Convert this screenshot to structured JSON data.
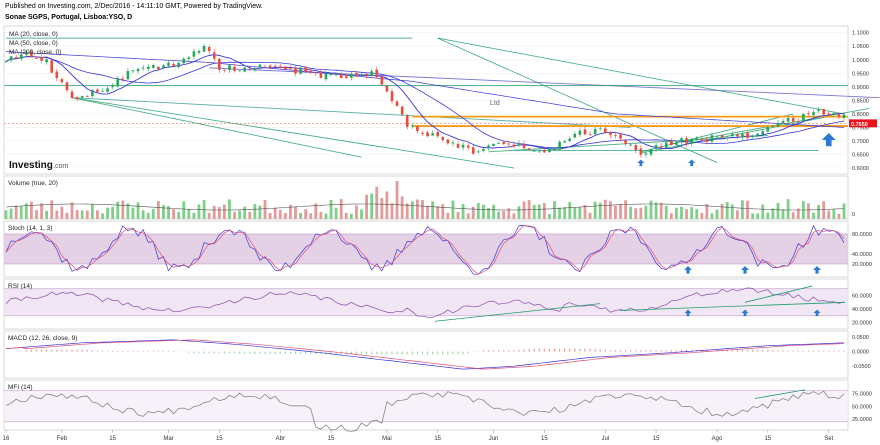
{
  "header": {
    "line1": "Published on Investing.com, 2/Dec/2016 - 14:11:10 GMT, Powered by TradingView.",
    "line2": "Sonae SGPS, Portugal, Lisboa:YSO, D"
  },
  "colors": {
    "up": "#26a65b",
    "down": "#e74c3c",
    "ma": "#3a36d8",
    "orange": "#f59c1a",
    "trend": "#1e9e6a",
    "arrow": "#2b7bd4",
    "stoch_bg": "#dec6e0",
    "rsi_bg": "#ede0f0",
    "mfi_bg": "#f5eef8",
    "price_tag": "#e8121b"
  },
  "chart_data": [
    {
      "type": "candlestick",
      "panel": "price",
      "legend": [
        "MA (20, close, 0)",
        "MA (50, close, 0)",
        "MA (200, close, 0)"
      ],
      "ylim": [
        0.6,
        1.11
      ],
      "yticks": [
        "1.1000",
        "1.0500",
        "1.0000",
        "0.9500",
        "0.9000",
        "0.8500",
        "0.8000",
        "0.7500",
        "0.7000",
        "0.6500",
        "0.6000"
      ],
      "last_price": "0.7650",
      "annotation": "Ltd",
      "brand": "Investing",
      "brand_suffix": ".com",
      "anchors": [
        [
          0,
          1.0
        ],
        [
          4,
          1.03
        ],
        [
          8,
          0.99
        ],
        [
          13,
          0.86
        ],
        [
          20,
          0.9
        ],
        [
          26,
          0.97
        ],
        [
          33,
          0.98
        ],
        [
          39,
          1.05
        ],
        [
          42,
          0.97
        ],
        [
          50,
          0.97
        ],
        [
          58,
          0.96
        ],
        [
          66,
          0.93
        ],
        [
          72,
          0.95
        ],
        [
          75,
          0.88
        ],
        [
          79,
          0.76
        ],
        [
          84,
          0.72
        ],
        [
          89,
          0.68
        ],
        [
          93,
          0.66
        ],
        [
          97,
          0.69
        ],
        [
          101,
          0.68
        ],
        [
          106,
          0.66
        ],
        [
          111,
          0.72
        ],
        [
          117,
          0.74
        ],
        [
          122,
          0.7
        ],
        [
          125,
          0.66
        ],
        [
          129,
          0.68
        ],
        [
          133,
          0.7
        ],
        [
          140,
          0.71
        ],
        [
          147,
          0.72
        ],
        [
          152,
          0.76
        ],
        [
          160,
          0.81
        ],
        [
          164,
          0.79
        ]
      ],
      "seed": 11
    },
    {
      "type": "bar",
      "panel": "volume",
      "title": "Volume (true, 20)",
      "yticks": [
        "0"
      ],
      "seed": 23
    },
    {
      "type": "line",
      "panel": "stoch",
      "title": "Stoch (14, 1, 3)",
      "ylim": [
        0,
        100
      ],
      "yticks": [
        "80.0000",
        "40.0000",
        "20.0000"
      ],
      "seed": 37
    },
    {
      "type": "line",
      "panel": "rsi",
      "title": "RSI (14)",
      "ylim": [
        15,
        80
      ],
      "yticks": [
        "60.0000",
        "40.0000",
        "20.0000"
      ],
      "seed": 41
    },
    {
      "type": "line",
      "panel": "macd",
      "title": "MACD (12, 26, close, 9)",
      "ylim": [
        -0.08,
        0.06
      ],
      "yticks": [
        "0.0500",
        "0.0000",
        "-0.0500"
      ],
      "seed": 53
    },
    {
      "type": "line",
      "panel": "mfi",
      "title": "MFI (14)",
      "ylim": [
        10,
        95
      ],
      "yticks": [
        "75.0000",
        "50.0000",
        "25.0000"
      ],
      "seed": 67
    }
  ],
  "x_axis": {
    "labels": [
      "16",
      "Feb",
      "15",
      "Mar",
      "15",
      "Abr",
      "15",
      "Mai",
      "15",
      "Jun",
      "15",
      "Jul",
      "15",
      "Ago",
      "15",
      "Set",
      "15",
      "Out",
      "15",
      "Nov",
      "15",
      "Dez",
      "15"
    ],
    "bar_index": [
      0,
      11,
      21,
      32,
      42,
      54,
      64,
      75,
      85,
      96,
      106,
      118,
      128,
      140,
      150,
      162,
      172,
      184,
      194,
      205,
      215,
      226,
      236
    ]
  }
}
